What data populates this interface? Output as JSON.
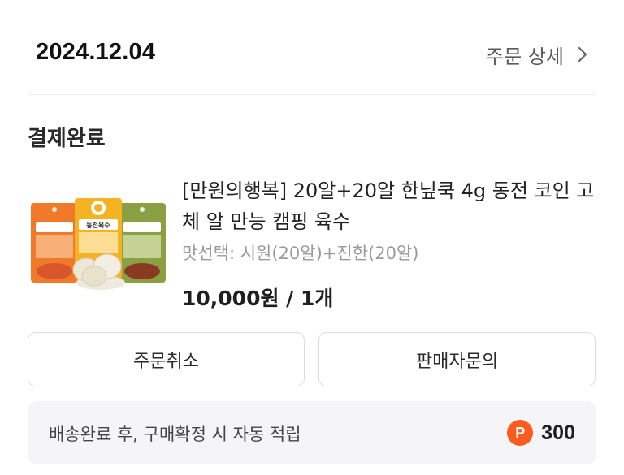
{
  "header": {
    "order_date": "2024.12.04",
    "detail_link_label": "주문 상세"
  },
  "order": {
    "status": "결제완료"
  },
  "product": {
    "title": "[만원의행복] 20알+20알 한닢쿡 4g 동전 코인 고체 알 만능 캠핑 육수",
    "option": "맛선택: 시원(20알)+진한(20알)",
    "price_qty": "10,000원 / 1개",
    "package_label": "동전육수"
  },
  "actions": {
    "cancel_label": "주문취소",
    "inquiry_label": "판매자문의"
  },
  "points": {
    "notice": "배송완료 후, 구매확정 시 자동 적립",
    "badge_letter": "P",
    "amount": "300"
  },
  "icons": {
    "chevron": "chevron-right-icon",
    "point": "point-coin-icon"
  },
  "colors": {
    "point_badge": "#ff5a1f",
    "pack_orange": "#f07a2a",
    "pack_yellow": "#f5b223",
    "pack_green": "#8aa043"
  }
}
